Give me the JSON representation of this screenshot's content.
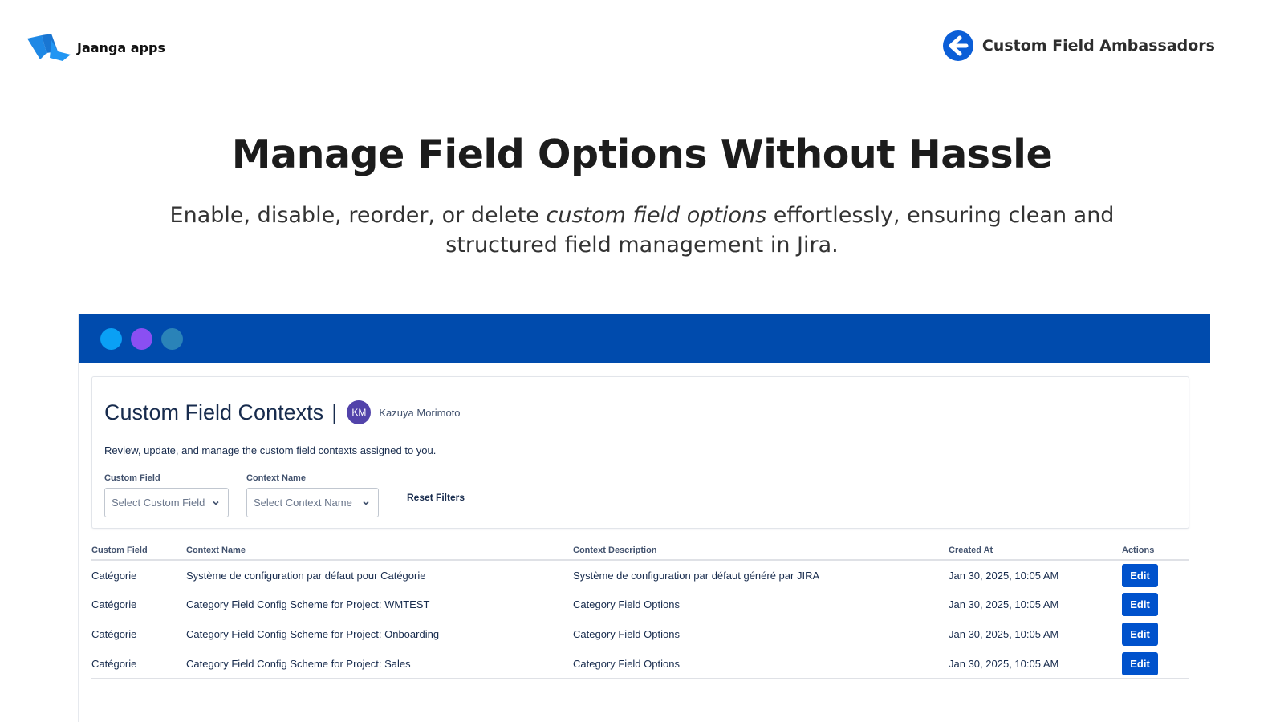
{
  "brand": {
    "name": "Jaanga apps"
  },
  "product": {
    "name": "Custom Field Ambassadors"
  },
  "hero": {
    "title": "Manage Field Options Without Hassle",
    "subtitle_pre": "Enable, disable, reorder, or delete ",
    "subtitle_em": "custom field options",
    "subtitle_post": " effortlessly, ensuring clean and structured field management in Jira."
  },
  "window": {
    "dot_colors": [
      "#0aa0f5",
      "#8a4ff2",
      "#2a83b8"
    ],
    "bar_color": "#004bad"
  },
  "panel": {
    "title": "Custom Field Contexts",
    "separator": "|",
    "user": {
      "initials": "KM",
      "name": "Kazuya Morimoto"
    },
    "description": "Review, update, and manage the custom field contexts assigned to you.",
    "filters": {
      "custom_field": {
        "label": "Custom Field",
        "placeholder": "Select Custom Field"
      },
      "context_name": {
        "label": "Context Name",
        "placeholder": "Select Context Name"
      },
      "reset_label": "Reset Filters"
    }
  },
  "table": {
    "headers": [
      "Custom Field",
      "Context Name",
      "Context Description",
      "Created At",
      "Actions"
    ],
    "rows": [
      {
        "field": "Catégorie",
        "context": "Système de configuration par défaut pour Catégorie",
        "description": "Système de configuration par défaut généré par JIRA",
        "created": "Jan 30, 2025, 10:05 AM",
        "action": "Edit"
      },
      {
        "field": "Catégorie",
        "context": "Category Field Config Scheme for Project: WMTEST",
        "description": "Category Field Options",
        "created": "Jan 30, 2025, 10:05 AM",
        "action": "Edit"
      },
      {
        "field": "Catégorie",
        "context": "Category Field Config Scheme for Project: Onboarding",
        "description": "Category Field Options",
        "created": "Jan 30, 2025, 10:05 AM",
        "action": "Edit"
      },
      {
        "field": "Catégorie",
        "context": "Category Field Config Scheme for Project: Sales",
        "description": "Category Field Options",
        "created": "Jan 30, 2025, 10:05 AM",
        "action": "Edit"
      }
    ]
  },
  "colors": {
    "accent": "#0052cc",
    "avatar": "#5243aa",
    "logo": "#1e88e5"
  }
}
